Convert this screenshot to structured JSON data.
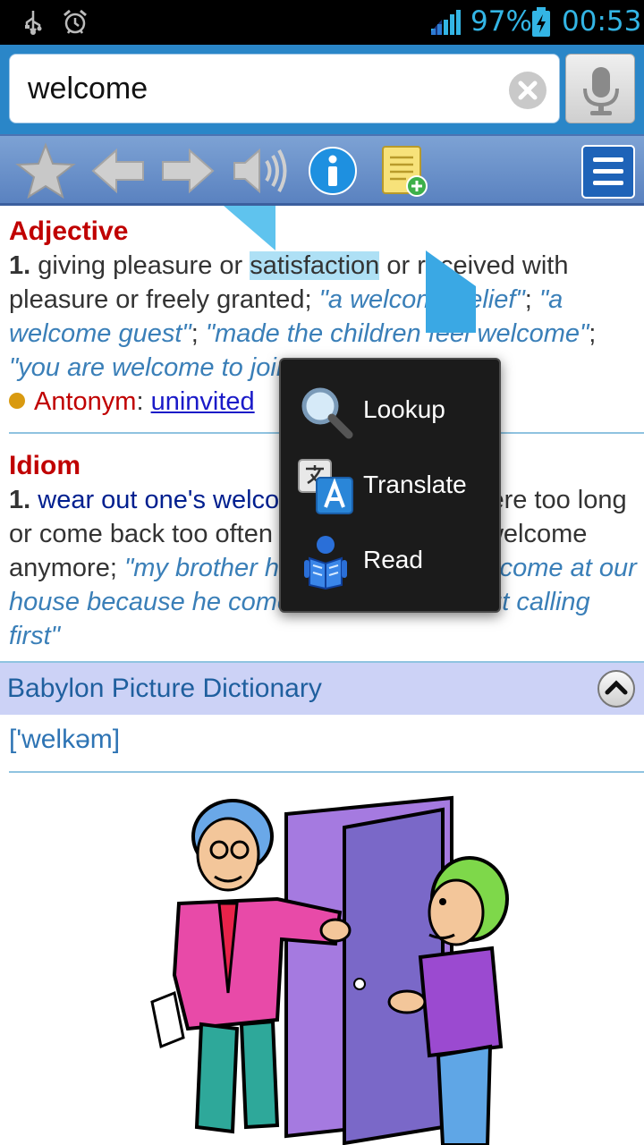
{
  "status_bar": {
    "battery_percent": "97%",
    "time": "00:53",
    "icons": [
      "usb-icon",
      "alarm-icon",
      "signal-icon",
      "battery-charging-icon"
    ]
  },
  "search": {
    "query": "welcome"
  },
  "toolbar": {
    "buttons": [
      "star-icon",
      "back-arrow-icon",
      "forward-arrow-icon",
      "speaker-icon",
      "info-icon",
      "add-note-icon",
      "menu-icon"
    ]
  },
  "entry": {
    "adjective": {
      "pos": "Adjective",
      "num": "1.",
      "def_before_selection": "giving pleasure or ",
      "selected_word": "satisfaction",
      "def_after_selection": " or received with pleasure or freely granted; ",
      "ex1": "\"a welcome relief\"",
      "ex2": "\"a welcome guest\"",
      "ex3": "\"made the children feel welcome\"",
      "ex4": "\"you are welcome to join us\"",
      "antonym_label": "Antonym",
      "antonym": "uninvited"
    },
    "idiom": {
      "pos": "Idiom",
      "num": "1.",
      "term": "wear out one's welcome",
      "def": " - stay somewhere too long or come back too often so that one is not welcome anymore; ",
      "example": "\"my brother has worn out his welcome at our house because he comes to visit us without calling first\""
    }
  },
  "picture_dictionary": {
    "title": "Babylon Picture Dictionary",
    "phonetic": "['welkəm]"
  },
  "context_menu": {
    "items": [
      {
        "label": "Lookup",
        "icon": "magnifier-icon"
      },
      {
        "label": "Translate",
        "icon": "translate-icon"
      },
      {
        "label": "Read",
        "icon": "read-icon"
      }
    ]
  },
  "colors": {
    "accent": "#33b5e5",
    "header_blue": "#2a86c8",
    "part_of_speech_red": "#c00000",
    "example_blue": "#3a7fb8",
    "section_bar": "#ccd2f6"
  }
}
